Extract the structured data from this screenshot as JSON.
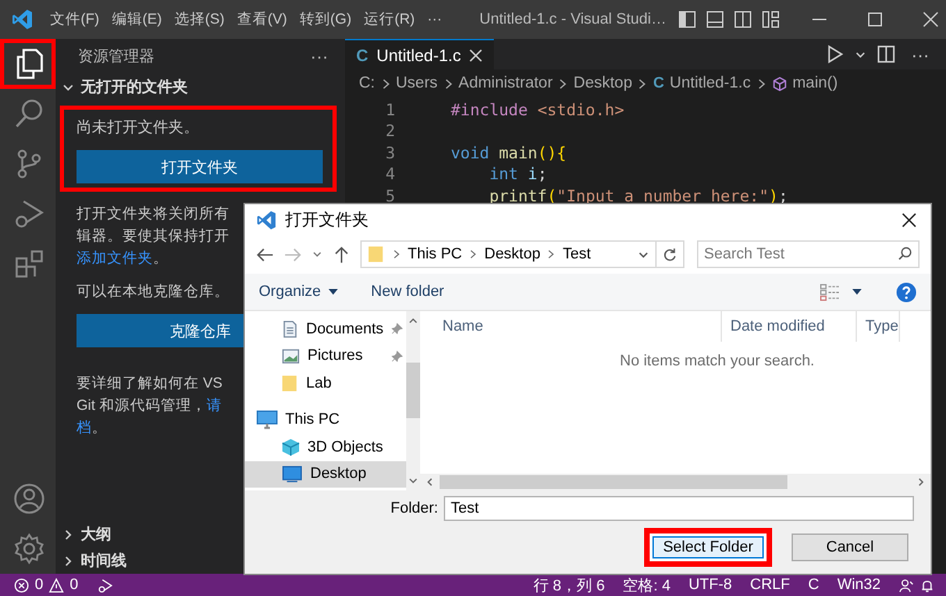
{
  "title_bar": {
    "menu": [
      "文件(F)",
      "编辑(E)",
      "选择(S)",
      "查看(V)",
      "转到(G)",
      "运行(R)",
      "···"
    ],
    "title": "Untitled-1.c - Visual Studi…"
  },
  "activity_bar": {
    "top": [
      {
        "kind": "explorer",
        "selected": true,
        "highlighted": true
      },
      {
        "kind": "search",
        "selected": false,
        "highlighted": false
      },
      {
        "kind": "source-control",
        "selected": false,
        "highlighted": false
      },
      {
        "kind": "run-debug",
        "selected": false,
        "highlighted": false
      },
      {
        "kind": "extensions",
        "selected": false,
        "highlighted": false
      }
    ],
    "bottom": [
      {
        "kind": "account"
      },
      {
        "kind": "settings"
      }
    ]
  },
  "sidebar": {
    "title": "资源管理器",
    "more": "···",
    "section": {
      "title": "无打开的文件夹",
      "expanded": true
    },
    "empty_panel": {
      "highlighted": true,
      "message": "尚未打开文件夹。",
      "button": "打开文件夹"
    },
    "notice_lines": [
      "打开文件夹将关闭所有",
      "辑器。要使其保持打开"
    ],
    "notice_link": "添加文件夹",
    "notice_end": "。",
    "clone_text": "可以在本地克隆仓库。",
    "clone_button": "克隆仓库",
    "learn_line_1": "要详细了解如何在 VS",
    "learn_line_2": "Git 和源代码管理，",
    "learn_link": "请",
    "learn_end_link": "档",
    "learn_end": "。",
    "bottom_sections": [
      {
        "title": "大纲",
        "expanded": false
      },
      {
        "title": "时间线",
        "expanded": false
      }
    ]
  },
  "editor": {
    "tab": {
      "icon": "C",
      "label": "Untitled-1.c",
      "selected": true
    },
    "breadcrumbs": [
      {
        "kind": "folder",
        "label": "C:"
      },
      {
        "kind": "folder",
        "label": "Users"
      },
      {
        "kind": "folder",
        "label": "Administrator"
      },
      {
        "kind": "folder",
        "label": "Desktop"
      },
      {
        "kind": "file",
        "icon": "C",
        "label": "Untitled-1.c"
      },
      {
        "kind": "symbol",
        "label": "main()"
      }
    ],
    "lines": [
      {
        "number": "1",
        "indented": false,
        "tokens": [
          {
            "kind": "directive",
            "text": "#include "
          },
          {
            "kind": "string",
            "text": "<stdio.h>"
          }
        ]
      },
      {
        "number": "2"
      },
      {
        "number": "3",
        "indented": false,
        "tokens": [
          {
            "kind": "keyword",
            "text": "void "
          },
          {
            "kind": "function",
            "text": "main"
          },
          {
            "kind": "bracket",
            "text": "(){"
          }
        ]
      },
      {
        "number": "4",
        "indented": true,
        "tokens": [
          {
            "kind": "keyword",
            "text": "int "
          },
          {
            "kind": "variable",
            "text": "i"
          },
          {
            "kind": "plain",
            "text": ";"
          }
        ]
      },
      {
        "number": "5",
        "indented": true,
        "tokens": [
          {
            "kind": "function",
            "text": "printf"
          },
          {
            "kind": "bracket",
            "text": "("
          },
          {
            "kind": "string",
            "text": "\"Input a number here:\""
          },
          {
            "kind": "bracket",
            "text": ")"
          },
          {
            "kind": "plain",
            "text": ";"
          }
        ]
      }
    ]
  },
  "dialog": {
    "title": "打开文件夹",
    "path": [
      "This PC",
      "Desktop",
      "Test"
    ],
    "search_placeholder": "Search Test",
    "toolbar": {
      "organize": "Organize",
      "new_folder": "New folder"
    },
    "quick_access": [
      {
        "kind": "documents",
        "label": "Documents",
        "pinned": true,
        "selected": false
      },
      {
        "kind": "pictures",
        "label": "Pictures",
        "pinned": true,
        "selected": false
      },
      {
        "kind": "folder",
        "label": "Lab",
        "pinned": false,
        "selected": false
      }
    ],
    "this_pc": {
      "label": "This PC",
      "children": [
        {
          "kind": "objects",
          "label": "3D Objects",
          "selected": false
        },
        {
          "kind": "desktop",
          "label": "Desktop",
          "selected": true
        }
      ]
    },
    "columns": [
      "Name",
      "Date modified",
      "Type"
    ],
    "empty_message": "No items match your search.",
    "folder_label": "Folder:",
    "folder_value": "Test",
    "buttons": [
      {
        "kind": "primary",
        "label": "Select Folder",
        "highlighted": true
      },
      {
        "kind": "secondary",
        "label": "Cancel",
        "highlighted": false
      }
    ]
  },
  "status_bar": {
    "errors": "0",
    "warnings": "0",
    "items": [
      "行 8，列 6",
      "空格: 4",
      "UTF-8",
      "CRLF",
      "C",
      "Win32"
    ]
  }
}
